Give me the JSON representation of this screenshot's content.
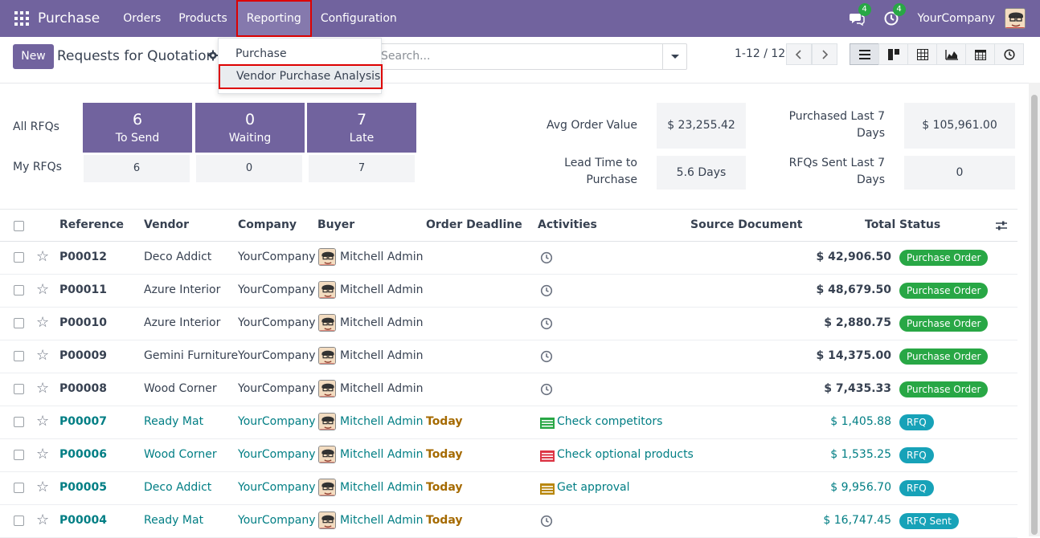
{
  "navbar": {
    "app_name": "Purchase",
    "menu": [
      "Orders",
      "Products",
      "Reporting",
      "Configuration"
    ],
    "messages_count": "4",
    "activities_count": "4",
    "company": "YourCompany"
  },
  "dropdown": {
    "items": [
      "Purchase",
      "Vendor Purchase Analysis"
    ]
  },
  "control": {
    "new_label": "New",
    "title": "Requests for Quotation",
    "search_placeholder": "Search...",
    "pager": "1-12 / 12"
  },
  "dashboard": {
    "all_rfqs_label": "All RFQs",
    "my_rfqs_label": "My RFQs",
    "tiles": [
      {
        "value": "6",
        "label": "To Send",
        "mine": "6"
      },
      {
        "value": "0",
        "label": "Waiting",
        "mine": "0"
      },
      {
        "value": "7",
        "label": "Late",
        "mine": "7"
      }
    ],
    "kpis": {
      "avg_order_label": "Avg Order Value",
      "avg_order_value": "$ 23,255.42",
      "purchased_label_1": "Purchased Last 7",
      "purchased_label_2": "Days",
      "purchased_value": "$ 105,961.00",
      "lead_label_1": "Lead Time to",
      "lead_label_2": "Purchase",
      "lead_value": "5.6 Days",
      "sent_label_1": "RFQs Sent Last 7",
      "sent_label_2": "Days",
      "sent_value": "0"
    }
  },
  "table": {
    "headers": {
      "reference": "Reference",
      "vendor": "Vendor",
      "company": "Company",
      "buyer": "Buyer",
      "deadline": "Order Deadline",
      "activities": "Activities",
      "source": "Source Document",
      "total": "Total",
      "status": "Status"
    },
    "rows": [
      {
        "ref": "P00012",
        "vendor": "Deco Addict",
        "company": "YourCompany",
        "buyer": "Mitchell Admin",
        "deadline": "",
        "activity": "",
        "total": "$ 42,906.50",
        "status": "Purchase Order"
      },
      {
        "ref": "P00011",
        "vendor": "Azure Interior",
        "company": "YourCompany",
        "buyer": "Mitchell Admin",
        "deadline": "",
        "activity": "",
        "total": "$ 48,679.50",
        "status": "Purchase Order"
      },
      {
        "ref": "P00010",
        "vendor": "Azure Interior",
        "company": "YourCompany",
        "buyer": "Mitchell Admin",
        "deadline": "",
        "activity": "",
        "total": "$ 2,880.75",
        "status": "Purchase Order"
      },
      {
        "ref": "P00009",
        "vendor": "Gemini Furniture",
        "company": "YourCompany",
        "buyer": "Mitchell Admin",
        "deadline": "",
        "activity": "",
        "total": "$ 14,375.00",
        "status": "Purchase Order"
      },
      {
        "ref": "P00008",
        "vendor": "Wood Corner",
        "company": "YourCompany",
        "buyer": "Mitchell Admin",
        "deadline": "",
        "activity": "",
        "total": "$ 7,435.33",
        "status": "Purchase Order"
      },
      {
        "ref": "P00007",
        "vendor": "Ready Mat",
        "company": "YourCompany",
        "buyer": "Mitchell Admin",
        "deadline": "Today",
        "activity": "Check competitors",
        "activity_color": "#28a745",
        "total": "$ 1,405.88",
        "status": "RFQ"
      },
      {
        "ref": "P00006",
        "vendor": "Wood Corner",
        "company": "YourCompany",
        "buyer": "Mitchell Admin",
        "deadline": "Today",
        "activity": "Check optional products",
        "activity_color": "#dc3545",
        "total": "$ 1,535.25",
        "status": "RFQ"
      },
      {
        "ref": "P00005",
        "vendor": "Deco Addict",
        "company": "YourCompany",
        "buyer": "Mitchell Admin",
        "deadline": "Today",
        "activity": "Get approval",
        "activity_color": "#b8860b",
        "total": "$ 9,956.70",
        "status": "RFQ"
      },
      {
        "ref": "P00004",
        "vendor": "Ready Mat",
        "company": "YourCompany",
        "buyer": "Mitchell Admin",
        "deadline": "Today",
        "activity": "",
        "total": "$ 16,747.45",
        "status": "RFQ Sent"
      }
    ]
  },
  "colors": {
    "brand": "#71639e",
    "link": "#017e84",
    "po_badge": "#28a745",
    "rfq_badge": "#17a2b8"
  }
}
